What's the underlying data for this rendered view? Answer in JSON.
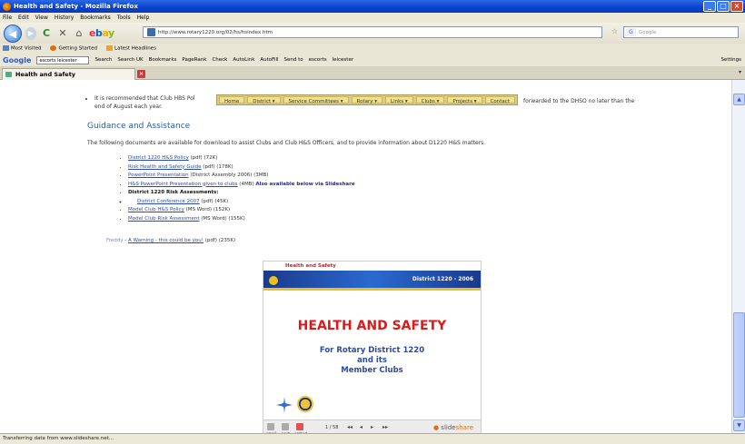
{
  "window": {
    "title": "Health and Safety - Mozilla Firefox",
    "controls": [
      "_",
      "□",
      "×"
    ]
  },
  "menu": [
    "File",
    "Edit",
    "View",
    "History",
    "Bookmarks",
    "Tools",
    "Help"
  ],
  "nav": {
    "url": "http://www.rotary1220.org/02/hs/hsindex.htm",
    "search_placeholder": "Google"
  },
  "bookmarks": [
    "Most Visited",
    "Getting Started",
    "Latest Headlines"
  ],
  "google_toolbar": {
    "query": "escorts leicester",
    "items": [
      "Search",
      "Search UK",
      "Bookmarks",
      "PageRank",
      "Check",
      "AutoLink",
      "AutoFill",
      "Send to",
      "escorts",
      "leicester"
    ],
    "settings": "Settings"
  },
  "tab": {
    "label": "Health and Safety"
  },
  "site_nav": [
    "Home",
    "District ▾",
    "Service Committees ▾",
    "Rotary ▾",
    "Links ▾",
    "Clubs ▾",
    "Projects ▾",
    "Contact"
  ],
  "page": {
    "bullet_top": "It is recommended that Club HBS Pol",
    "bullet_top_line2": "end of August each year.",
    "bullet_top_right": "forwarded to the DHSO no later than the",
    "heading": "Guidance and Assistance",
    "intro": "The following documents are available for download to assist Clubs and Club H&S Officers, and to provide information about D1220 H&S matters.",
    "docs": [
      {
        "link": "District 1220 H&S Policy",
        "meta": " (pdf) (72K)"
      },
      {
        "link": "Risk Health and Safety Guide",
        "meta": " (pdf) (178K)"
      },
      {
        "link": "PowerPoint Presentation",
        "meta": " (District Assembly 2006) (3MB)"
      },
      {
        "link": "H&S PowerPoint Presentation given to clubs",
        "meta": " (4MB) ",
        "note": "Also available below via Slideshare"
      },
      {
        "bold": "District 1220 Risk Assessments:"
      },
      {
        "link": "Model Club H&S Policy",
        "meta": " (MS Word) (152K)"
      },
      {
        "link": "Model Club Risk Assessment",
        "meta": " (MS Word) (155K)"
      }
    ],
    "sub_doc": {
      "link": "District Conference 2007",
      "meta": " (pdf) (45K)"
    },
    "freddy": {
      "name": "Freddy",
      "sep": " - ",
      "link": "A Warning - this could be you!",
      "meta": " (pdf) (235K)"
    }
  },
  "slide": {
    "header": "Health and Safety",
    "band_text": "District 1220 - 2006",
    "title": "HEALTH AND SAFETY",
    "sub1": "For Rotary District 1220",
    "sub2": "and its",
    "sub3": "Member Clubs",
    "page": "1 / 58",
    "nav": [
      "◂◂",
      "◂",
      "▸",
      "▸▸"
    ],
    "icon_labels": [
      "email",
      "post",
      "embed"
    ],
    "brand": "slide",
    "brand2": "share"
  },
  "status": "Transferring data from www.slideshare.net..."
}
